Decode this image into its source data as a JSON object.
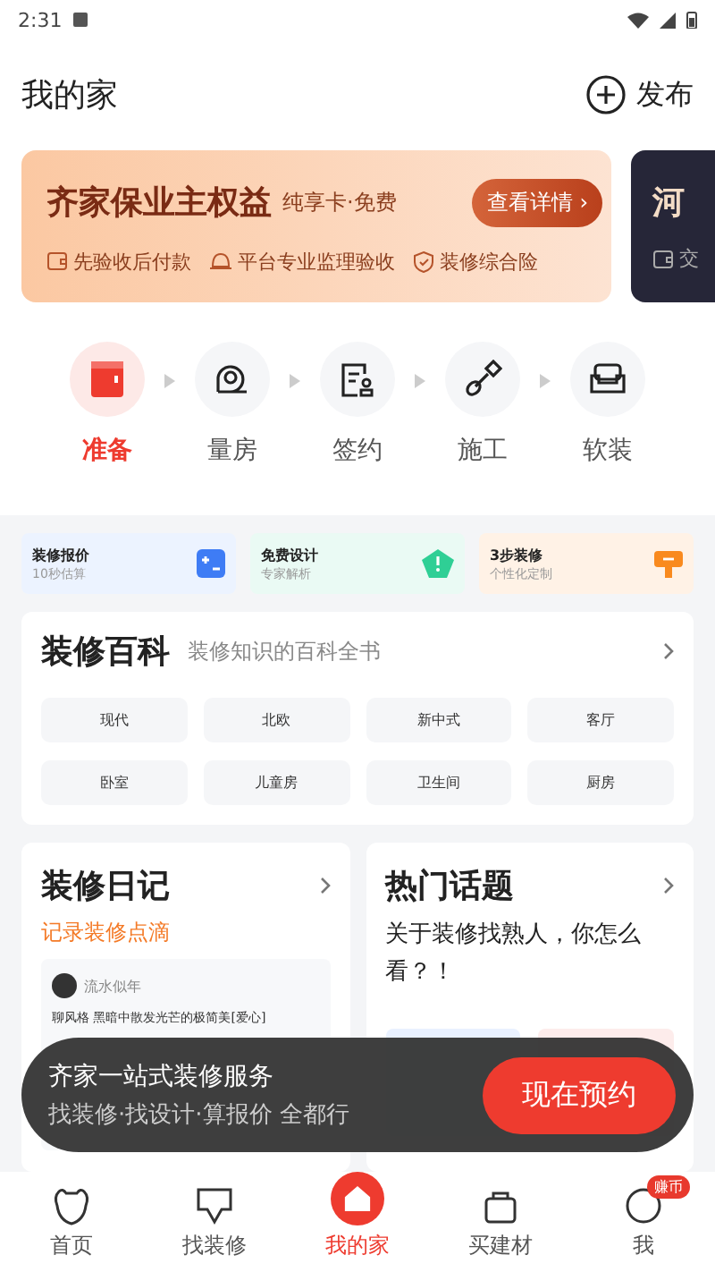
{
  "status_bar": {
    "time": "2:31"
  },
  "header": {
    "title": "我的家",
    "publish": "发布"
  },
  "banners": [
    {
      "title": "齐家保业主权益",
      "subtitle": "纯享卡·免费",
      "button": "查看详情 ›",
      "features": [
        {
          "kind": "wallet",
          "text": "先验收后付款"
        },
        {
          "kind": "helmet",
          "text": "平台专业监理验收"
        },
        {
          "kind": "shield",
          "text": "装修综合险"
        }
      ]
    },
    {
      "title": "河",
      "features": [
        {
          "kind": "wallet",
          "text": "交"
        }
      ]
    }
  ],
  "steps": [
    {
      "kind": "prepare",
      "label": "准备",
      "selected": true
    },
    {
      "kind": "measure",
      "label": "量房",
      "selected": false
    },
    {
      "kind": "contract",
      "label": "签约",
      "selected": false
    },
    {
      "kind": "build",
      "label": "施工",
      "selected": false
    },
    {
      "kind": "sofa",
      "label": "软装",
      "selected": false
    }
  ],
  "quick": [
    {
      "kind": "quote",
      "title": "装修报价",
      "sub": "10秒估算",
      "color": "#ecf3ff"
    },
    {
      "kind": "design",
      "title": "免费设计",
      "sub": "专家解析",
      "color": "#eafaf4"
    },
    {
      "kind": "steps",
      "title": "3步装修",
      "sub": "个性化定制",
      "color": "#fff2e6"
    }
  ],
  "encyclopedia": {
    "title": "装修百科",
    "subtitle": "装修知识的百科全书",
    "tags": [
      "现代",
      "北欧",
      "新中式",
      "客厅",
      "卧室",
      "儿童房",
      "卫生间",
      "厨房"
    ]
  },
  "diary": {
    "title": "装修日记",
    "subtitle": "记录装修点滴",
    "author": "流水似年",
    "text": "聊风格 黑暗中散发光芒的极简美[爱心]"
  },
  "topics": {
    "title": "热门话题",
    "question": "关于装修找熟人，你怎么看？！"
  },
  "toast": {
    "title": "齐家一站式装修服务",
    "text": "找装修·找设计·算报价 全都行",
    "button": "现在预约"
  },
  "nav": [
    {
      "kind": "home",
      "label": "首页",
      "selected": false
    },
    {
      "kind": "find",
      "label": "找装修",
      "selected": false
    },
    {
      "kind": "house",
      "label": "我的家",
      "selected": true
    },
    {
      "kind": "bag",
      "label": "买建材",
      "selected": false
    },
    {
      "kind": "me",
      "label": "我",
      "selected": false,
      "badge": "赚币"
    }
  ]
}
